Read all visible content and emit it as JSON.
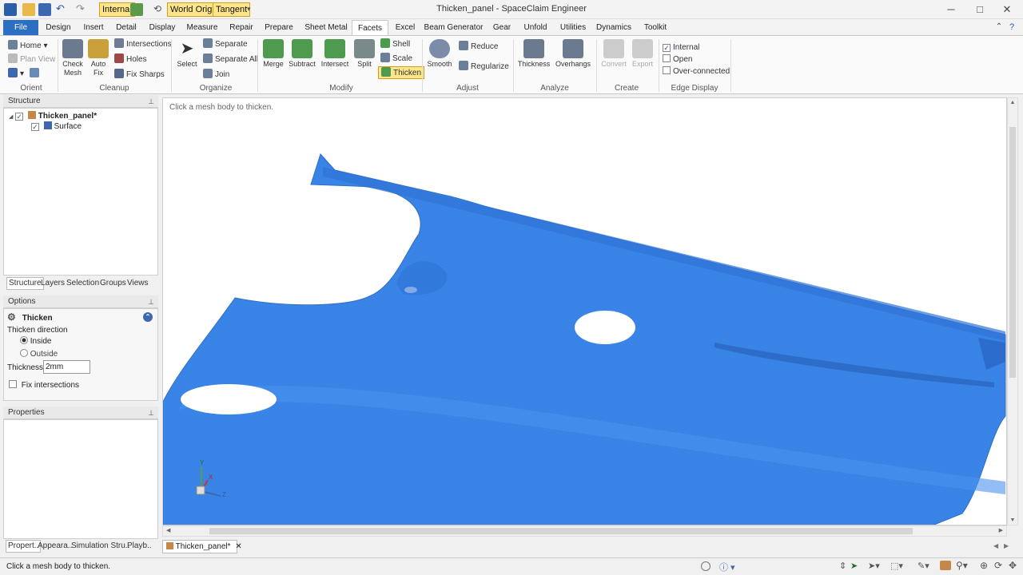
{
  "window": {
    "title": "Thicken_panel - SpaceClaim Engineer"
  },
  "quick_access": {
    "internal_label": "Internal",
    "world_origin_label": "World Origin",
    "tangent_label": "Tangent"
  },
  "tabs": [
    "File",
    "Design",
    "Insert",
    "Detail",
    "Display",
    "Measure",
    "Repair",
    "Prepare",
    "Sheet Metal",
    "Facets",
    "Excel",
    "Beam Generator",
    "Gear",
    "Unfold",
    "Utilities",
    "Dynamics",
    "Toolkit"
  ],
  "ribbon": {
    "orient": {
      "home": "Home",
      "plan_view": "Plan View",
      "label": "Orient"
    },
    "cleanup": {
      "check_mesh": "Check Mesh",
      "auto_fix": "Auto Fix",
      "intersections": "Intersections",
      "holes": "Holes",
      "fix_sharps": "Fix Sharps",
      "label": "Cleanup"
    },
    "organize": {
      "select": "Select",
      "separate": "Separate",
      "separate_all": "Separate All",
      "join": "Join",
      "label": "Organize"
    },
    "modify": {
      "merge": "Merge",
      "subtract": "Subtract",
      "intersect": "Intersect",
      "split": "Split",
      "shell": "Shell",
      "scale": "Scale",
      "thicken": "Thicken",
      "label": "Modify"
    },
    "adjust": {
      "smooth": "Smooth",
      "reduce": "Reduce",
      "regularize": "Regularize",
      "label": "Adjust"
    },
    "analyze": {
      "thickness": "Thickness",
      "overhangs": "Overhangs",
      "label": "Analyze"
    },
    "create": {
      "convert": "Convert",
      "export": "Export",
      "label": "Create"
    },
    "edge_display": {
      "internal": "Internal",
      "open": "Open",
      "over_connected": "Over-connected",
      "label": "Edge Display"
    }
  },
  "structure": {
    "title": "Structure",
    "root": "Thicken_panel*",
    "child": "Surface",
    "subtabs": [
      "Structure",
      "Layers",
      "Selection",
      "Groups",
      "Views"
    ]
  },
  "options": {
    "title": "Options",
    "tool": "Thicken",
    "direction_label": "Thicken direction",
    "inside": "Inside",
    "outside": "Outside",
    "thickness_label": "Thickness",
    "thickness_value": "2mm",
    "fix_intersections": "Fix intersections"
  },
  "properties": {
    "title": "Properties",
    "bottom_tabs": [
      "Propert..",
      "Appeara..",
      "Simulation Stru..",
      "Playb.."
    ]
  },
  "viewport": {
    "hint": "Click a mesh body to thicken.",
    "doc_tab": "Thicken_panel*",
    "axes": {
      "x": "X",
      "y": "Y",
      "z": "Z"
    },
    "mesh_color": "#3a86e8"
  },
  "status": {
    "message": "Click a mesh body to thicken."
  }
}
